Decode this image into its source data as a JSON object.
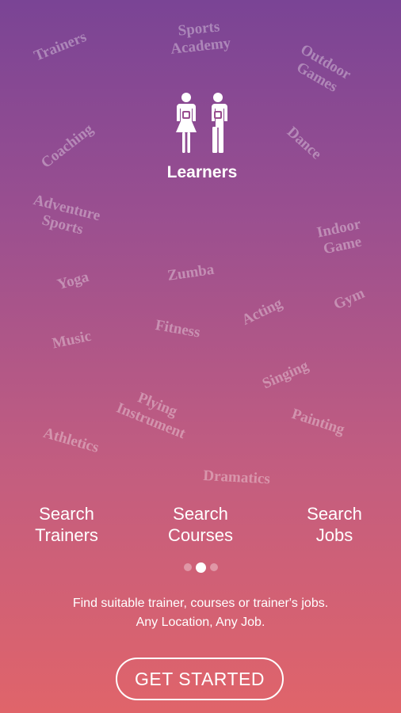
{
  "background_words": [
    "Trainers",
    "Sports\nAcademy",
    "Outdoor\nGames",
    "Coaching",
    "Dance",
    "Adventure\nSports",
    "Indoor\nGame",
    "Yoga",
    "Zumba",
    "Acting",
    "Gym",
    "Music",
    "Fitness",
    "Singing",
    "Plying\nInstrument",
    "Painting",
    "Athletics",
    "Dramatics"
  ],
  "hero": {
    "icon": "learners-icon",
    "label": "Learners"
  },
  "options": [
    {
      "label": "Search\nTrainers"
    },
    {
      "label": "Search\nCourses"
    },
    {
      "label": "Search\nJobs"
    }
  ],
  "pager": {
    "count": 3,
    "active_index": 1
  },
  "tagline": {
    "line1": "Find suitable trainer, courses or trainer's  jobs.",
    "line2": "Any Location, Any Job."
  },
  "cta_label": "GET STARTED",
  "colors": {
    "gradient_top": "#7a4495",
    "gradient_bottom": "#e0646a",
    "text": "#ffffff"
  }
}
